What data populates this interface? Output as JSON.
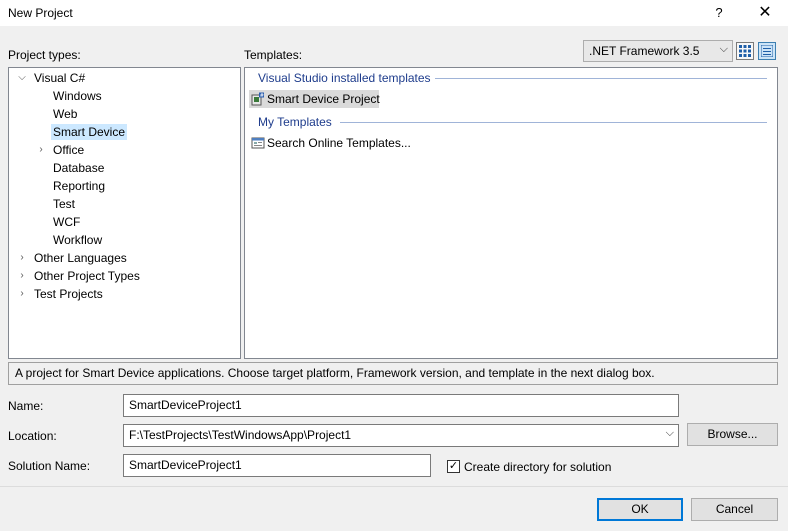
{
  "window": {
    "title": "New Project",
    "help_label": "?",
    "close_label": "✕"
  },
  "project_types": {
    "label": "Project types:",
    "items": [
      {
        "label": "Visual C#",
        "caret": "⌵",
        "level": 0
      },
      {
        "label": "Windows",
        "caret": "",
        "level": 1
      },
      {
        "label": "Web",
        "caret": "",
        "level": 1
      },
      {
        "label": "Smart Device",
        "caret": "",
        "level": 1,
        "selected": true
      },
      {
        "label": "Office",
        "caret": "›",
        "level": 1
      },
      {
        "label": "Database",
        "caret": "",
        "level": 1
      },
      {
        "label": "Reporting",
        "caret": "",
        "level": 1
      },
      {
        "label": "Test",
        "caret": "",
        "level": 1
      },
      {
        "label": "WCF",
        "caret": "",
        "level": 1
      },
      {
        "label": "Workflow",
        "caret": "",
        "level": 1
      },
      {
        "label": "Other Languages",
        "caret": "›",
        "level": 0
      },
      {
        "label": "Other Project Types",
        "caret": "›",
        "level": 0
      },
      {
        "label": "Test Projects",
        "caret": "›",
        "level": 0
      }
    ]
  },
  "templates": {
    "label": "Templates:",
    "framework_selected": ".NET Framework 3.5",
    "framework_chevron": "⌵",
    "groups": [
      {
        "heading": "Visual Studio installed templates",
        "items": [
          {
            "label": "Smart Device Project",
            "icon": "smart-device-project-icon",
            "selected": true
          }
        ]
      },
      {
        "heading": "My Templates",
        "items": [
          {
            "label": "Search Online Templates...",
            "icon": "search-online-templates-icon",
            "selected": false
          }
        ]
      }
    ]
  },
  "description": "A project for Smart Device applications. Choose target platform, Framework version, and template in the next dialog box.",
  "form": {
    "name_label": "Name:",
    "name_value": "SmartDeviceProject1",
    "location_label": "Location:",
    "location_value": "F:\\TestProjects\\TestWindowsApp\\Project1",
    "location_chevron": "⌵",
    "browse_label": "Browse...",
    "solution_label": "Solution Name:",
    "solution_value": "SmartDeviceProject1",
    "create_dir_label": "Create directory for solution",
    "create_dir_checked": true,
    "check_mark": "✓"
  },
  "buttons": {
    "ok_label": "OK",
    "cancel_label": "Cancel"
  },
  "colors": {
    "accent": "#0078d7",
    "selection": "#cce8ff",
    "group_heading": "#1e3c8c"
  }
}
